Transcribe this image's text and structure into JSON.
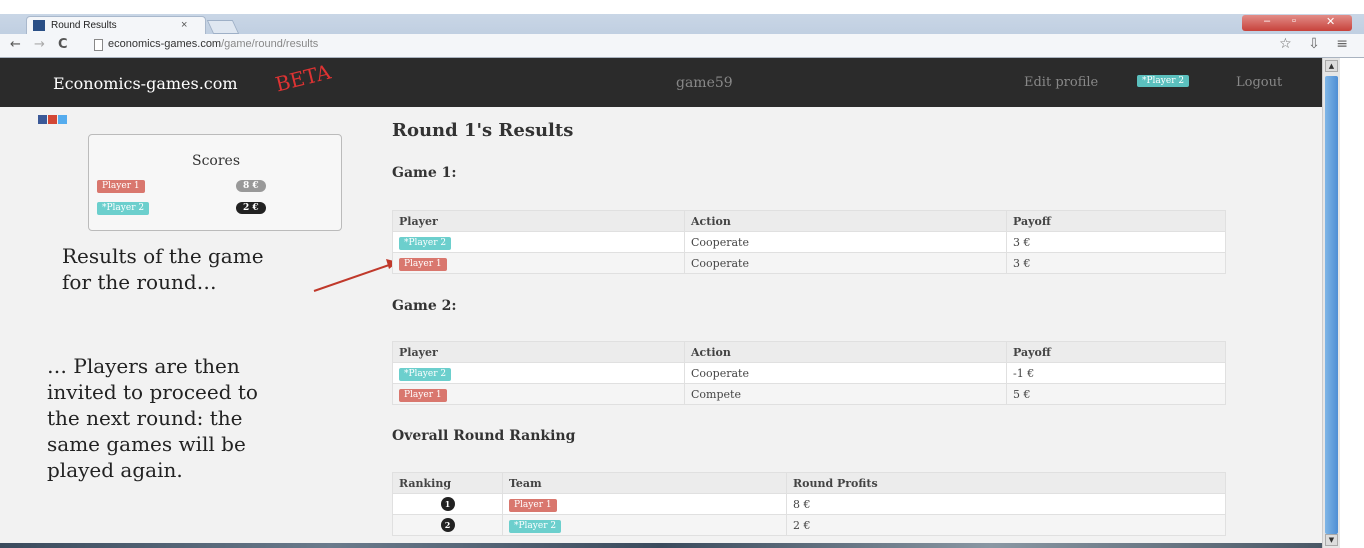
{
  "browser": {
    "tab_title": "Round Results",
    "tab_close": "×",
    "url_domain": "economics-games.com",
    "url_path": "/game/round/results",
    "back": "←",
    "forward": "→",
    "reload": "C",
    "toolbar_icons": "☆ ⇩ ≡"
  },
  "navbar": {
    "brand": "Economics-games.com",
    "beta": "BETA",
    "game_name": "game59",
    "edit_profile": "Edit profile",
    "current_player": "*Player 2",
    "logout": "Logout"
  },
  "scores": {
    "title": "Scores",
    "rows": [
      {
        "player": "Player 1",
        "score": "8 €"
      },
      {
        "player": "*Player 2",
        "score": "2 €"
      }
    ]
  },
  "annotations": {
    "first": [
      "Results of the game",
      "for the round…"
    ],
    "second": [
      "… Players are then",
      "invited to proceed to",
      "the next round: the",
      "same games will be",
      "played again."
    ]
  },
  "main": {
    "title": "Round 1's Results",
    "games": [
      {
        "heading": "Game 1:",
        "columns": [
          "Player",
          "Action",
          "Payoff"
        ],
        "rows": [
          {
            "player": "*Player 2",
            "action": "Cooperate",
            "payoff": "3 €"
          },
          {
            "player": "Player 1",
            "action": "Cooperate",
            "payoff": "3 €"
          }
        ]
      },
      {
        "heading": "Game 2:",
        "columns": [
          "Player",
          "Action",
          "Payoff"
        ],
        "rows": [
          {
            "player": "*Player 2",
            "action": "Cooperate",
            "payoff": "-1 €"
          },
          {
            "player": "Player 1",
            "action": "Compete",
            "payoff": "5 €"
          }
        ]
      }
    ],
    "ranking": {
      "heading": "Overall Round Ranking",
      "columns": [
        "Ranking",
        "Team",
        "Round Profits"
      ],
      "rows": [
        {
          "rank": "1",
          "team": "Player 1",
          "profit": "8 €"
        },
        {
          "rank": "2",
          "team": "*Player 2",
          "profit": "2 €"
        }
      ]
    }
  },
  "colors": {
    "player1": "#d9776e",
    "player2": "#6ccfcd",
    "navbar": "#2b2b2b",
    "arrow": "#c0392b"
  }
}
